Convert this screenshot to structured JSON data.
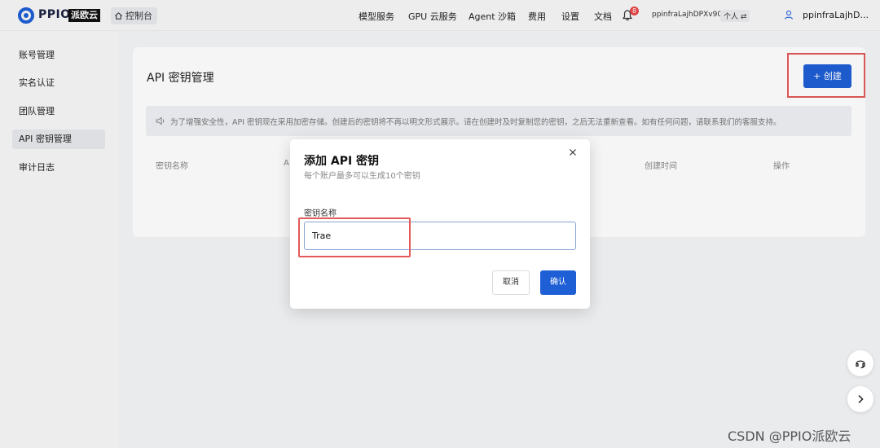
{
  "header": {
    "logo_text": "PPIO",
    "logo_badge": "派欧云",
    "console_label": "控制台",
    "nav": [
      "模型服务",
      "GPU 云服务",
      "Agent 沙箱",
      "费用",
      "设置",
      "文档"
    ],
    "notification_count": "8",
    "account_id": "ppinfraLajhDPXv90",
    "account_type": "个人",
    "username": "ppinfraLajhD..."
  },
  "sidebar": {
    "items": [
      {
        "label": "账号管理",
        "active": false
      },
      {
        "label": "实名认证",
        "active": false
      },
      {
        "label": "团队管理",
        "active": false
      },
      {
        "label": "API 密钥管理",
        "active": true
      },
      {
        "label": "审计日志",
        "active": false
      }
    ]
  },
  "main": {
    "title": "API 密钥管理",
    "create_label": "创建",
    "notice": "为了增强安全性，API 密钥现在采用加密存储。创建后的密钥将不再以明文形式展示。请在创建时及时复制您的密钥，之后无法重新查看。如有任何问题，请联系我们的客服支持。",
    "columns": [
      "密钥名称",
      "A",
      "创建时间",
      "操作"
    ]
  },
  "modal": {
    "title": "添加 API 密钥",
    "subtitle": "每个账户最多可以生成10个密钥",
    "field_label": "密钥名称",
    "input_value": "Trae",
    "cancel_label": "取消",
    "confirm_label": "确认"
  },
  "watermark": "CSDN @PPIO派欧云",
  "colors": {
    "primary": "#1f5fd6",
    "highlight_box": "#e25a5a",
    "badge": "#e84545"
  }
}
